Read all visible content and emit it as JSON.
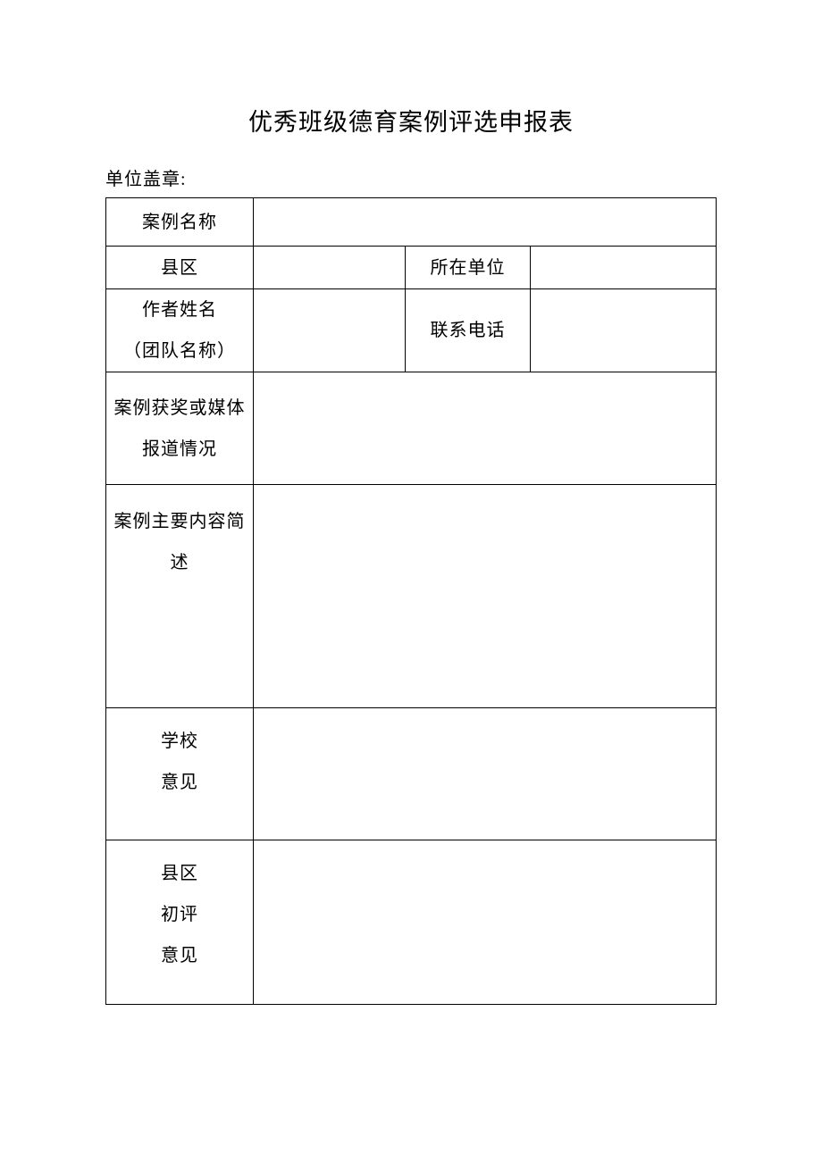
{
  "title": "优秀班级德育案例评选申报表",
  "stamp_label": "单位盖章:",
  "rows": {
    "case_name_label": "案例名称",
    "case_name_value": "",
    "county_label": "县区",
    "county_value": "",
    "unit_label": "所在单位",
    "unit_value": "",
    "author_label_line1": "作者姓名",
    "author_label_line2": "（团队名称）",
    "author_value": "",
    "phone_label": "联系电话",
    "phone_value": "",
    "award_label_line1": "案例获奖或媒体",
    "award_label_line2": "报道情况",
    "award_value": "",
    "summary_label_line1": "案例主要内容简",
    "summary_label_line2": "述",
    "summary_value": "",
    "school_opinion_label_line1": "学校",
    "school_opinion_label_line2": "意见",
    "school_opinion_value": "",
    "county_opinion_label_line1": "县区",
    "county_opinion_label_line2": "初评",
    "county_opinion_label_line3": "意见",
    "county_opinion_value": ""
  }
}
